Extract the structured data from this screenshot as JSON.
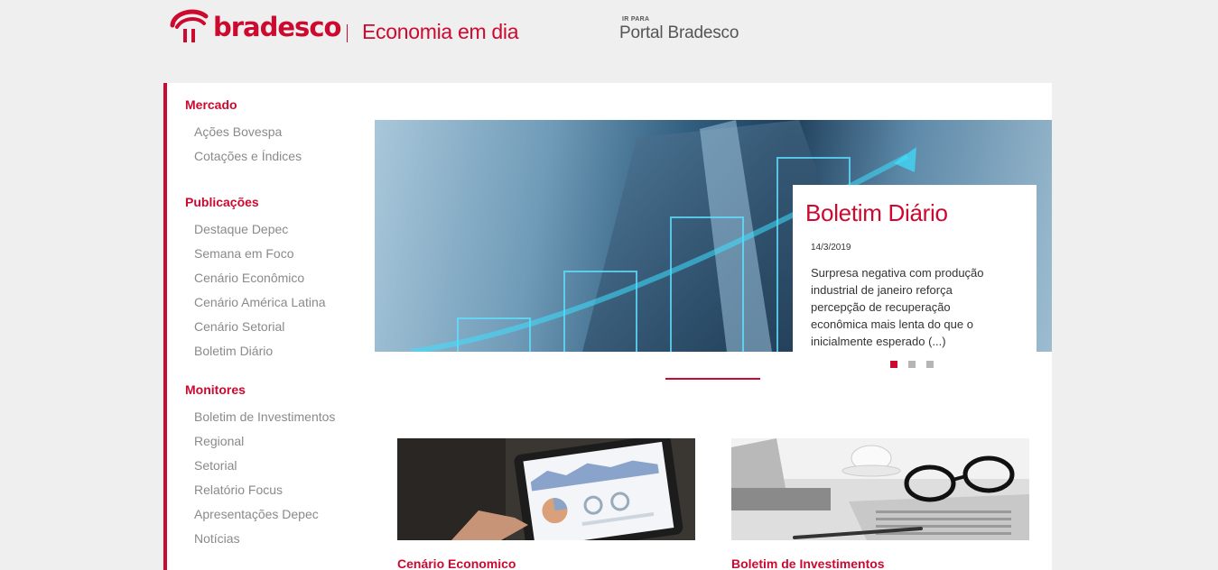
{
  "header": {
    "brand": "bradesco",
    "tagline": "Economia em dia",
    "portal_small": "IR PARA",
    "portal_big": "Portal Bradesco"
  },
  "sidebar": {
    "sections": [
      {
        "heading": "Mercado",
        "items": [
          "Ações Bovespa",
          "Cotações e Índices"
        ]
      },
      {
        "heading": "Publicações",
        "items": [
          "Destaque Depec",
          "Semana em Foco",
          "Cenário Econômico",
          "Cenário América Latina",
          "Cenário Setorial",
          "Boletim Diário"
        ]
      },
      {
        "heading": "Monitores",
        "items": [
          "Boletim de Investimentos",
          "Regional",
          "Setorial",
          "Relatório Focus",
          "Apresentações Depec",
          "Notícias"
        ]
      }
    ]
  },
  "hero": {
    "title": "Boletim Diário",
    "date": "14/3/2019",
    "text": "Surpresa negativa com produção industrial de janeiro reforça percepção de recuperação econômica mais lenta do que o inicialmente esperado (...)",
    "slide_count": 3,
    "active_slide": 1
  },
  "cards": [
    {
      "title": "Cenário Economico",
      "image": "tablet-charts-photo"
    },
    {
      "title": "Boletim de Investimentos",
      "image": "newspaper-glasses-photo"
    }
  ],
  "colors": {
    "brand": "#cc092f",
    "muted": "#8a8a8a",
    "background": "#efefef"
  },
  "icons": {
    "logo": "bradesco-logo-icon"
  }
}
